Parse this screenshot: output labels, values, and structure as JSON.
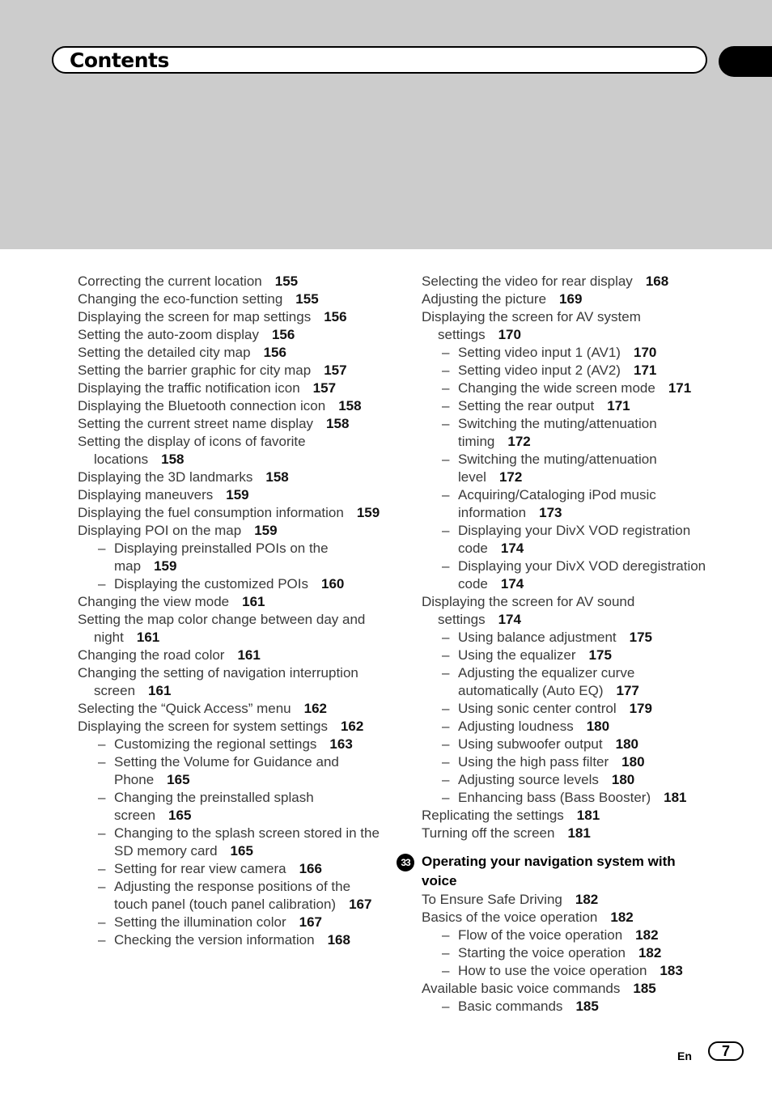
{
  "header": {
    "title": "Contents"
  },
  "left_column": [
    {
      "level": 1,
      "title": "Correcting the current location",
      "page": "155"
    },
    {
      "level": 1,
      "title": "Changing the eco-function setting",
      "page": "155"
    },
    {
      "level": 1,
      "title": "Displaying the screen for map settings",
      "page": "156"
    },
    {
      "level": 1,
      "title": "Setting the auto-zoom display",
      "page": "156"
    },
    {
      "level": 1,
      "title": "Setting the detailed city map",
      "page": "156"
    },
    {
      "level": 1,
      "title": "Setting the barrier graphic for city map",
      "page": "157"
    },
    {
      "level": 1,
      "title": "Displaying the traffic notification icon",
      "page": "157"
    },
    {
      "level": 1,
      "title": "Displaying the Bluetooth connection icon",
      "page": "158"
    },
    {
      "level": 1,
      "title": "Setting the current street name display",
      "page": "158"
    },
    {
      "level": 1,
      "title": "Setting the display of icons of favorite locations",
      "page": "158"
    },
    {
      "level": 1,
      "title": "Displaying the 3D landmarks",
      "page": "158"
    },
    {
      "level": 1,
      "title": "Displaying maneuvers",
      "page": "159"
    },
    {
      "level": 1,
      "title": "Displaying the fuel consumption information",
      "page": "159"
    },
    {
      "level": 1,
      "title": "Displaying POI on the map",
      "page": "159"
    },
    {
      "level": 2,
      "title": "Displaying preinstalled POIs on the map",
      "page": "159"
    },
    {
      "level": 2,
      "title": "Displaying the customized POIs",
      "page": "160"
    },
    {
      "level": 1,
      "title": "Changing the view mode",
      "page": "161"
    },
    {
      "level": 1,
      "title": "Setting the map color change between day and night",
      "page": "161"
    },
    {
      "level": 1,
      "title": "Changing the road color",
      "page": "161"
    },
    {
      "level": 1,
      "title": "Changing the setting of navigation interruption screen",
      "page": "161"
    },
    {
      "level": 1,
      "title": "Selecting the “Quick Access” menu",
      "page": "162"
    },
    {
      "level": 1,
      "title": "Displaying the screen for system settings",
      "page": "162"
    },
    {
      "level": 2,
      "title": "Customizing the regional settings",
      "page": "163"
    },
    {
      "level": 2,
      "title": "Setting the Volume for Guidance and Phone",
      "page": "165"
    },
    {
      "level": 2,
      "title": "Changing the preinstalled splash screen",
      "page": "165"
    },
    {
      "level": 2,
      "title": "Changing to the splash screen stored in the SD memory card",
      "page": "165"
    },
    {
      "level": 2,
      "title": "Setting for rear view camera",
      "page": "166"
    },
    {
      "level": 2,
      "title": "Adjusting the response positions of the touch panel (touch panel calibration)",
      "page": "167"
    },
    {
      "level": 2,
      "title": "Setting the illumination color",
      "page": "167"
    },
    {
      "level": 2,
      "title": "Checking the version information",
      "page": "168"
    }
  ],
  "right_column": [
    {
      "level": 1,
      "title": "Selecting the video for rear display",
      "page": "168"
    },
    {
      "level": 1,
      "title": "Adjusting the picture",
      "page": "169"
    },
    {
      "level": 1,
      "title": "Displaying the screen for AV system settings",
      "page": "170"
    },
    {
      "level": 2,
      "title": "Setting video input 1 (AV1)",
      "page": "170"
    },
    {
      "level": 2,
      "title": "Setting video input 2 (AV2)",
      "page": "171"
    },
    {
      "level": 2,
      "title": "Changing the wide screen mode",
      "page": "171"
    },
    {
      "level": 2,
      "title": "Setting the rear output",
      "page": "171"
    },
    {
      "level": 2,
      "title": "Switching the muting/attenuation timing",
      "page": "172"
    },
    {
      "level": 2,
      "title": "Switching the muting/attenuation level",
      "page": "172"
    },
    {
      "level": 2,
      "title": "Acquiring/Cataloging iPod music information",
      "page": "173"
    },
    {
      "level": 2,
      "title": "Displaying your DivX VOD registration code",
      "page": "174"
    },
    {
      "level": 2,
      "title": "Displaying your DivX VOD deregistration code",
      "page": "174"
    },
    {
      "level": 1,
      "title": "Displaying the screen for AV sound settings",
      "page": "174"
    },
    {
      "level": 2,
      "title": "Using balance adjustment",
      "page": "175"
    },
    {
      "level": 2,
      "title": "Using the equalizer",
      "page": "175"
    },
    {
      "level": 2,
      "title": "Adjusting the equalizer curve automatically (Auto EQ)",
      "page": "177"
    },
    {
      "level": 2,
      "title": "Using sonic center control",
      "page": "179"
    },
    {
      "level": 2,
      "title": "Adjusting loudness",
      "page": "180"
    },
    {
      "level": 2,
      "title": "Using subwoofer output",
      "page": "180"
    },
    {
      "level": 2,
      "title": "Using the high pass filter",
      "page": "180"
    },
    {
      "level": 2,
      "title": "Adjusting source levels",
      "page": "180"
    },
    {
      "level": 2,
      "title": "Enhancing bass (Bass Booster)",
      "page": "181"
    },
    {
      "level": 1,
      "title": "Replicating the settings",
      "page": "181"
    },
    {
      "level": 1,
      "title": "Turning off the screen",
      "page": "181"
    }
  ],
  "chapter": {
    "number": "33",
    "title": "Operating your navigation system with voice",
    "entries": [
      {
        "level": 1,
        "title": "To Ensure Safe Driving",
        "page": "182"
      },
      {
        "level": 1,
        "title": "Basics of the voice operation",
        "page": "182"
      },
      {
        "level": 2,
        "title": "Flow of the voice operation",
        "page": "182"
      },
      {
        "level": 2,
        "title": "Starting the voice operation",
        "page": "182"
      },
      {
        "level": 2,
        "title": "How to use the voice operation",
        "page": "183"
      },
      {
        "level": 1,
        "title": "Available basic voice commands",
        "page": "185"
      },
      {
        "level": 2,
        "title": "Basic commands",
        "page": "185"
      }
    ]
  },
  "footer": {
    "language": "En",
    "page_number": "7"
  },
  "dash_glyph": "–"
}
